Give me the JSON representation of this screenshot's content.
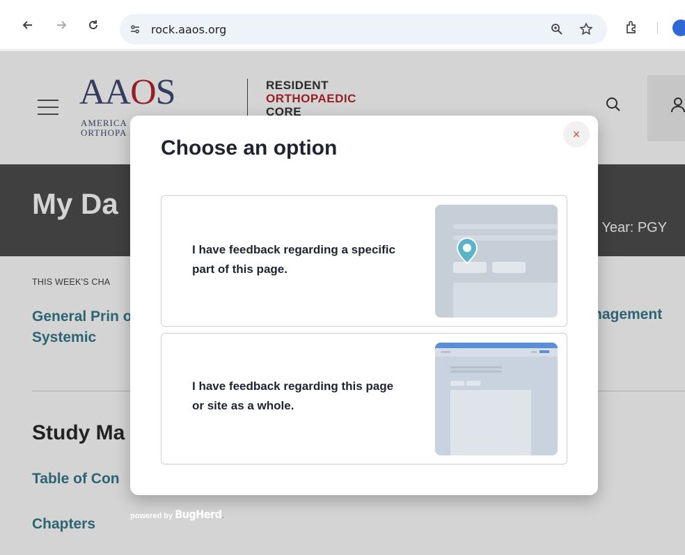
{
  "browser": {
    "url": "rock.aaos.org",
    "icons": [
      "back-icon",
      "forward-icon",
      "reload-icon",
      "site-info-icon",
      "zoom-icon",
      "bookmark-star-icon",
      "extensions-icon",
      "profile-icon"
    ]
  },
  "site": {
    "logo_text": "AAOS",
    "logo_sub1": "AMERICA",
    "logo_sub2": "ORTHOPA",
    "rock_line1": "RESIDENT",
    "rock_line2": "ORTHOPAEDIC",
    "rock_line3": "CORE",
    "banner_title": "My Da",
    "banner_year": "n Year:  PGY",
    "week_label": "THIS WEEK'S CHA",
    "chapter_link": "General Prin of Systemic",
    "chapter_link_right": "nagement",
    "study_title": "Study Ma",
    "toc_link": "Table of Con",
    "chapters_link": "Chapters"
  },
  "modal": {
    "title": "Choose an option",
    "close_label": "×",
    "options": [
      {
        "text": "I have feedback regarding a specific part of this page."
      },
      {
        "text": "I have feedback regarding this page or site as a whole."
      }
    ]
  },
  "footer": {
    "powered_by": "powered by",
    "brand": "BugHerd"
  },
  "colors": {
    "brand_navy": "#3f4a70",
    "brand_red": "#b5262d",
    "link_teal": "#35798b",
    "banner_gray": "#4d4d4d",
    "pin_teal": "#5ab3c7",
    "close_red": "#d0463f"
  }
}
